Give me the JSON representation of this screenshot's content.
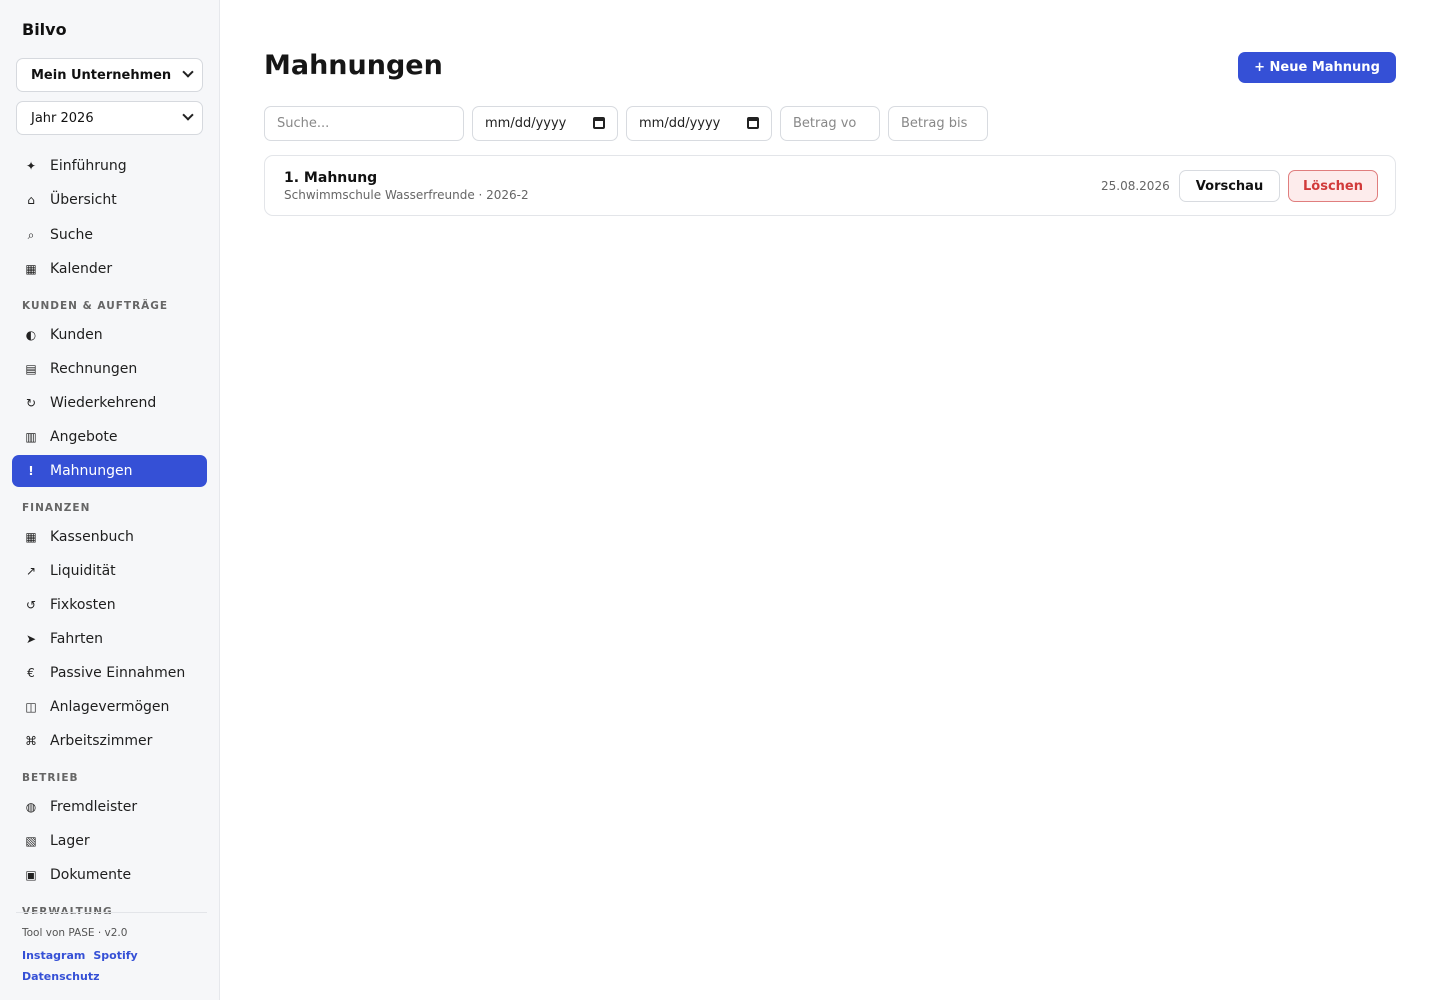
{
  "app": {
    "brand": "Bilvo"
  },
  "sidebar": {
    "company_select": "Mein Unternehmen",
    "year_select": "Jahr 2026",
    "top_items": [
      {
        "icon": "✦",
        "label": "Einführung"
      },
      {
        "icon": "⌂",
        "label": "Übersicht"
      },
      {
        "icon": "⌕",
        "label": "Suche"
      },
      {
        "icon": "▦",
        "label": "Kalender"
      }
    ],
    "sections": [
      {
        "title": "KUNDEN & AUFTRÄGE",
        "items": [
          {
            "icon": "◐",
            "label": "Kunden"
          },
          {
            "icon": "▤",
            "label": "Rechnungen"
          },
          {
            "icon": "↻",
            "label": "Wiederkehrend"
          },
          {
            "icon": "▥",
            "label": "Angebote"
          },
          {
            "icon": "!",
            "label": "Mahnungen",
            "active": true
          }
        ]
      },
      {
        "title": "FINANZEN",
        "items": [
          {
            "icon": "▦",
            "label": "Kassenbuch"
          },
          {
            "icon": "↗",
            "label": "Liquidität"
          },
          {
            "icon": "↺",
            "label": "Fixkosten"
          },
          {
            "icon": "➤",
            "label": "Fahrten"
          },
          {
            "icon": "€",
            "label": "Passive Einnahmen"
          },
          {
            "icon": "◫",
            "label": "Anlagevermögen"
          },
          {
            "icon": "⌘",
            "label": "Arbeitszimmer"
          }
        ]
      },
      {
        "title": "BETRIEB",
        "items": [
          {
            "icon": "◍",
            "label": "Fremdleister"
          },
          {
            "icon": "▧",
            "label": "Lager"
          },
          {
            "icon": "▣",
            "label": "Dokumente"
          }
        ]
      },
      {
        "title": "VERWALTUNG",
        "items": []
      }
    ],
    "footer": {
      "version": "Tool von PASE · v2.0",
      "link_instagram": "Instagram",
      "link_spotify": "Spotify",
      "link_privacy": "Datenschutz"
    }
  },
  "main": {
    "title": "Mahnungen",
    "new_button": "+ Neue Mahnung",
    "filters": {
      "search_placeholder": "Suche...",
      "date_from": "mm/dd/yyyy",
      "date_to": "mm/dd/yyyy",
      "amount_from_placeholder": "Betrag vo",
      "amount_to_placeholder": "Betrag bis"
    },
    "reminders": [
      {
        "title": "1. Mahnung",
        "subtitle": "Schwimmschule Wasserfreunde · 2026-2",
        "date": "25.08.2026",
        "preview_label": "Vorschau",
        "delete_label": "Löschen"
      }
    ]
  },
  "colors": {
    "accent": "#3550d6",
    "danger": "#d13a3a",
    "danger_bg": "#fdecec"
  }
}
